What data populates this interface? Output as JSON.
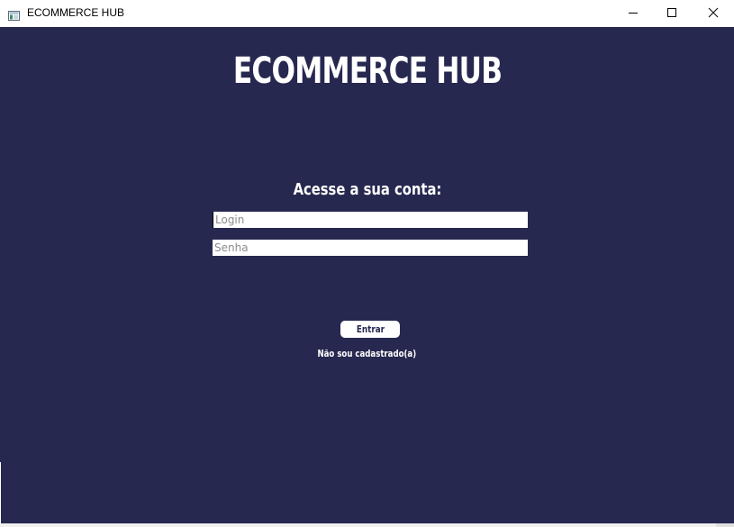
{
  "window": {
    "title": "ECOMMERCE HUB",
    "icon": "app-window-icon",
    "controls": {
      "minimize_icon": "minimize-icon",
      "maximize_icon": "maximize-icon",
      "close_icon": "close-icon"
    }
  },
  "colors": {
    "background": "#272850",
    "text": "#ffffff",
    "field_background": "#ffffff",
    "placeholder": "#8c8c8c"
  },
  "main": {
    "app_title": "ECOMMERCE HUB",
    "subtitle": "Acesse a sua conta:",
    "login_field": {
      "value": "",
      "placeholder": "Login"
    },
    "password_field": {
      "value": "",
      "placeholder": "Senha"
    },
    "enter_button_label": "Entrar",
    "register_link_label": "Não sou cadastrado(a)"
  }
}
